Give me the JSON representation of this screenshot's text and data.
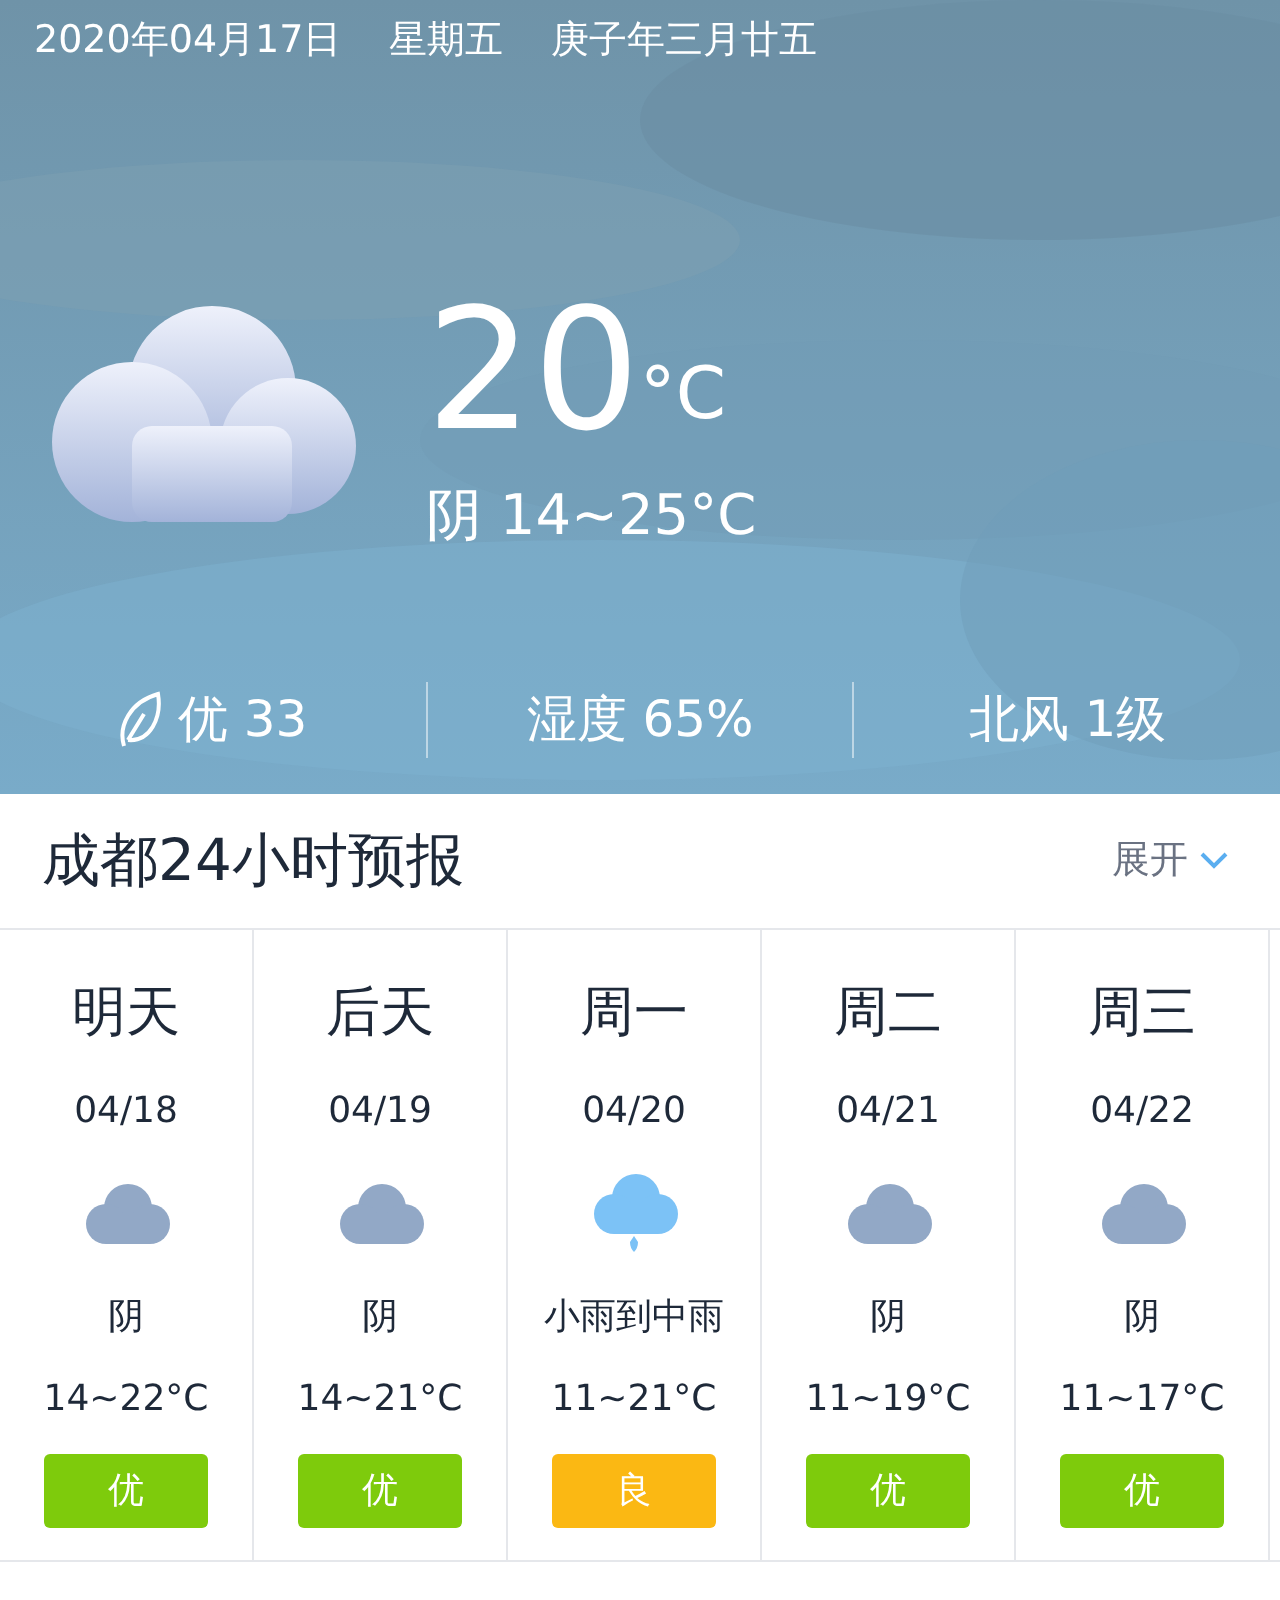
{
  "header": {
    "date": "2020年04月17日",
    "weekday": "星期五",
    "lunar_date": "庚子年三月廿五",
    "temperature": "20",
    "unit": "°C",
    "condition": "阴 14~25°C",
    "stats": [
      {
        "kind": "air",
        "text": "优 33"
      },
      {
        "kind": "plain",
        "text": "湿度 65%"
      },
      {
        "kind": "plain",
        "text": "北风 1级"
      }
    ]
  },
  "forecast": {
    "title": "成都24小时预报",
    "expand_label": "展开",
    "days": [
      {
        "day": "明天",
        "date": "04/18",
        "kind": "cloudy",
        "condition": "阴",
        "temps": "14~22°C",
        "aqi": "优",
        "color": "#7ecb0c"
      },
      {
        "day": "后天",
        "date": "04/19",
        "kind": "cloudy",
        "condition": "阴",
        "temps": "14~21°C",
        "aqi": "优",
        "color": "#7ecb0c"
      },
      {
        "day": "周一",
        "date": "04/20",
        "kind": "rain",
        "condition": "小雨到中雨",
        "temps": "11~21°C",
        "aqi": "良",
        "color": "#fbb813"
      },
      {
        "day": "周二",
        "date": "04/21",
        "kind": "cloudy",
        "condition": "阴",
        "temps": "11~19°C",
        "aqi": "优",
        "color": "#7ecb0c"
      },
      {
        "day": "周三",
        "date": "04/22",
        "kind": "cloudy",
        "condition": "阴",
        "temps": "11~17°C",
        "aqi": "优",
        "color": "#7ecb0c"
      }
    ]
  }
}
